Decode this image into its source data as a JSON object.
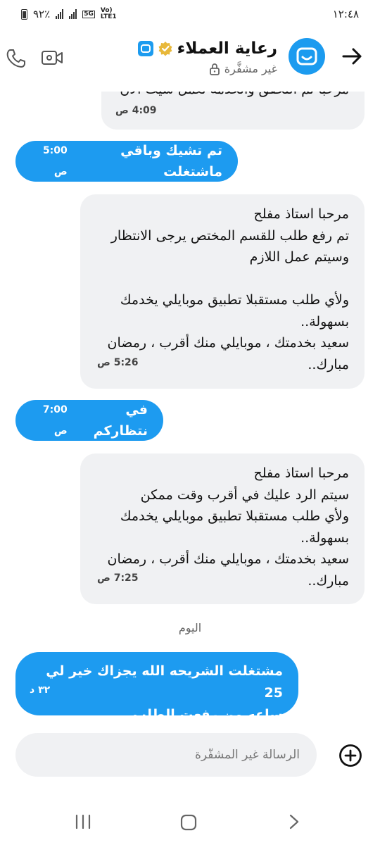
{
  "status_bar": {
    "time": "١٢:٤٨",
    "battery": "٩٢٪",
    "network_5g": "5G",
    "network_lte": "Vo) LTE1"
  },
  "header": {
    "title": "رعاية العملاء",
    "subtitle": "غير مشفَّرة",
    "accent": "#1d9bf0"
  },
  "messages": [
    {
      "dir": "in",
      "text": "مرحبا تم التحقق والخدمة تعمل شيت الان",
      "time": "4:09 ص"
    },
    {
      "dir": "out",
      "text": "تم تشيك وباقي ماشتغلت",
      "time": "5:00 ص"
    },
    {
      "dir": "in",
      "lines": [
        "مرحبا استاذ مفلح",
        "تم رفع طلب للقسم المختص يرجى الانتظار",
        "وسيتم عمل اللازم",
        "",
        "ولأي طلب مستقبلا تطبيق موبايلي يخدمك",
        "بسهولة..",
        "سعيد بخدمتك ، موبايلي منك أقرب ، رمضان",
        "مبارك.."
      ],
      "time": "5:26 ص"
    },
    {
      "dir": "out",
      "text": "في نتظاركم",
      "time": "7:00 ص"
    },
    {
      "dir": "in",
      "lines": [
        "مرحبا استاذ مفلح",
        "سيتم الرد عليك في أقرب وقت ممكن",
        "ولأي طلب مستقبلا تطبيق موبايلي يخدمك",
        "بسهولة..",
        "سعيد بخدمتك ، موبايلي منك أقرب ، رمضان",
        "مبارك.."
      ],
      "time": "7:25 ص"
    },
    {
      "dir": "out",
      "lines": [
        "مشتغلت الشريحه الله يجزاك خير لي 25",
        "ساعه من رفعت الطلب"
      ],
      "time": "٣٢ د"
    }
  ],
  "day_label": "اليوم",
  "composer": {
    "placeholder": "الرسالة غير المشفَّرة"
  },
  "icons": {
    "back": "arrow-right-icon",
    "avatar": "mobily-logo-icon",
    "verified": "verified-badge-icon",
    "lock": "lock-icon",
    "video": "video-call-icon",
    "phone": "phone-call-icon",
    "add": "add-circle-icon"
  }
}
